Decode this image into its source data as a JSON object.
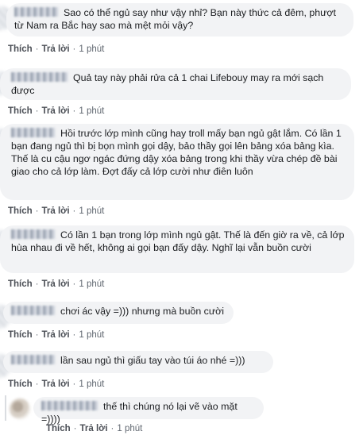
{
  "comments": [
    {
      "text": "Sao có thể ngủ say như vậy nhỉ? Bạn này thức cả đêm, phượt từ Nam ra Bắc hay sao mà mệt mỏi vậy?",
      "like": "Thích",
      "reply": "Trả lời",
      "time": "1 phút"
    },
    {
      "text": "Quả tay này phải rửa cả 1 chai Lifebouy may ra mới sạch được",
      "like": "Thích",
      "reply": "Trả lời",
      "time": "1 phút"
    },
    {
      "text": "Hồi trước lớp mình cũng hay troll mấy bạn ngủ gật lắm. Có lần 1 bạn đang ngủ thì bị bọn mình gọi dậy, bảo thầy gọi lên bảng xóa bảng kìa. Thế là cu cậu ngơ ngác đứng dậy xóa bảng trong khi thầy vừa chép đề bài giao cho cả lớp làm. Đợt đấy cả lớp cười như điên luôn",
      "like": "Thích",
      "reply": "Trả lời",
      "time": "1 phút"
    },
    {
      "text": "Có lần 1 bạn trong lớp mình ngủ gật. Thế là đến giờ ra về, cả lớp hùa nhau đi về hết, không ai gọi bạn đấy dậy. Nghĩ lại vẫn buồn cười",
      "like": "Thích",
      "reply": "Trả lời",
      "time": "1 phút"
    },
    {
      "text": "chơi ác vậy =))) nhưng mà buồn cười",
      "like": "Thích",
      "reply": "Trả lời",
      "time": "1 phút"
    },
    {
      "text": "lần sau ngủ thì giấu tay vào túi áo nhé =)))",
      "like": "Thích",
      "reply": "Trả lời",
      "time": "1 phút"
    },
    {
      "text": "thế thì chúng nó lại vẽ vào mặt =))))",
      "like": "Thích",
      "reply": "Trả lời",
      "time": "1 phút"
    }
  ]
}
